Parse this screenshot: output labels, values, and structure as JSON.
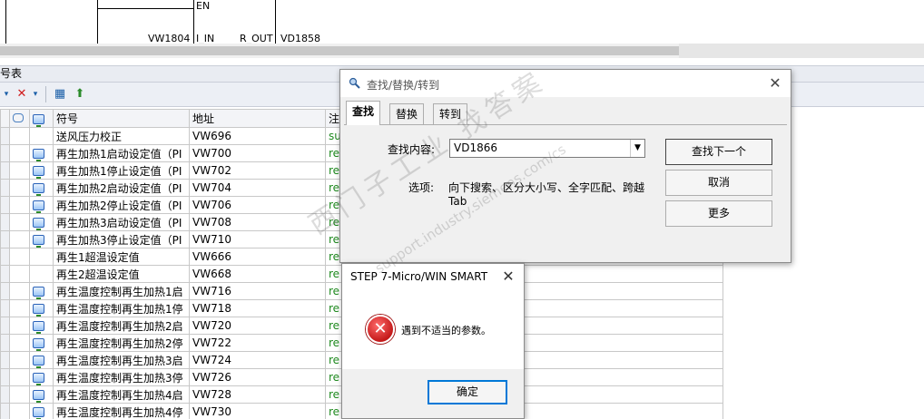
{
  "ladder": {
    "en_label": "EN",
    "in_addr": "VW1804",
    "in_pin": "I_IN",
    "out_pin": "R_OUT",
    "out_addr": "VD1858"
  },
  "panel": {
    "title": "号表"
  },
  "table": {
    "headers": [
      "符号",
      "地址",
      "注"
    ],
    "rows": [
      {
        "icon": false,
        "symbol": "送风压力校正",
        "address": "VW696",
        "comment": "su"
      },
      {
        "icon": true,
        "symbol": "再生加热1启动设定值（PI",
        "address": "VW700",
        "comment": "re"
      },
      {
        "icon": true,
        "symbol": "再生加热1停止设定值（PI",
        "address": "VW702",
        "comment": "re"
      },
      {
        "icon": true,
        "symbol": "再生加热2启动设定值（PI",
        "address": "VW704",
        "comment": "re"
      },
      {
        "icon": true,
        "symbol": "再生加热2停止设定值（PI",
        "address": "VW706",
        "comment": "re"
      },
      {
        "icon": true,
        "symbol": "再生加热3启动设定值（PI",
        "address": "VW708",
        "comment": "re"
      },
      {
        "icon": true,
        "symbol": "再生加热3停止设定值（PI",
        "address": "VW710",
        "comment": "re"
      },
      {
        "icon": false,
        "symbol": "再生1超温设定值",
        "address": "VW666",
        "comment": "re"
      },
      {
        "icon": false,
        "symbol": "再生2超温设定值",
        "address": "VW668",
        "comment": "re"
      },
      {
        "icon": true,
        "symbol": "再生温度控制再生加热1启",
        "address": "VW716",
        "comment": "re"
      },
      {
        "icon": true,
        "symbol": "再生温度控制再生加热1停",
        "address": "VW718",
        "comment": "re"
      },
      {
        "icon": true,
        "symbol": "再生温度控制再生加热2启",
        "address": "VW720",
        "comment": "re"
      },
      {
        "icon": true,
        "symbol": "再生温度控制再生加热2停",
        "address": "VW722",
        "comment": "re"
      },
      {
        "icon": true,
        "symbol": "再生温度控制再生加热3启",
        "address": "VW724",
        "comment": "re"
      },
      {
        "icon": true,
        "symbol": "再生温度控制再生加热3停",
        "address": "VW726",
        "comment": "re"
      },
      {
        "icon": true,
        "symbol": "再生温度控制再生加热4启",
        "address": "VW728",
        "comment": "re"
      },
      {
        "icon": true,
        "symbol": "再生温度控制再生加热4停",
        "address": "VW730",
        "comment": "re"
      }
    ]
  },
  "find_dialog": {
    "title": "查找/替换/转到",
    "tabs": [
      "查找",
      "替换",
      "转到"
    ],
    "active_tab": "查找",
    "find_label": "查找内容:",
    "find_value": "VD1866",
    "options_label": "选项:",
    "options_line1": "向下搜索、区分大小写、全字匹配、跨越",
    "options_line2": "Tab",
    "find_next": "查找下一个",
    "cancel": "取消",
    "more": "更多"
  },
  "error_dialog": {
    "title": "STEP 7-Micro/WIN SMART",
    "message": "遇到不适当的参数。",
    "ok": "确定"
  },
  "watermark": {
    "text": "西门子工业 找答案",
    "url": "support.industry.siemens.com/cs"
  }
}
